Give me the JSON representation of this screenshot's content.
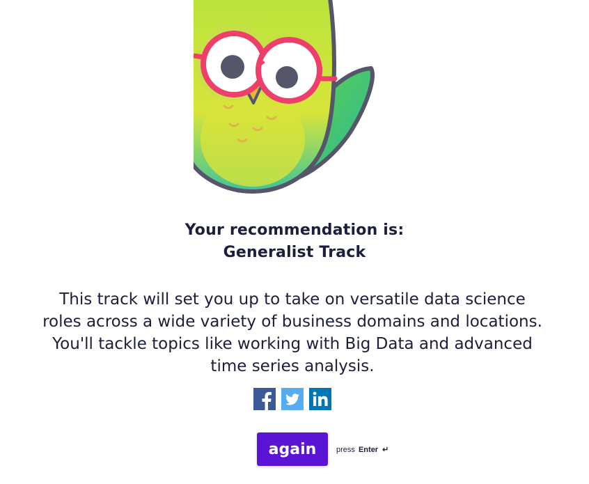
{
  "result": {
    "heading_line1": "Your recommendation is:",
    "heading_line2": "Generalist Track",
    "description": "This track will set you up to take on versatile data science roles across a wide variety of business domains and locations. You'll tackle topics like working with Big Data and advanced time series analysis."
  },
  "share": {
    "icons": [
      "facebook-icon",
      "twitter-icon",
      "linkedin-icon"
    ],
    "colors": {
      "facebook": "#3b5998",
      "twitter": "#55acee",
      "linkedin": "#0077b5"
    }
  },
  "action": {
    "button_label": "again",
    "hint_prefix": "press",
    "hint_key": "Enter",
    "hint_icon": "↵",
    "accent": "#5a14d6"
  },
  "illustration": {
    "name": "owl-with-glasses-illustration"
  }
}
